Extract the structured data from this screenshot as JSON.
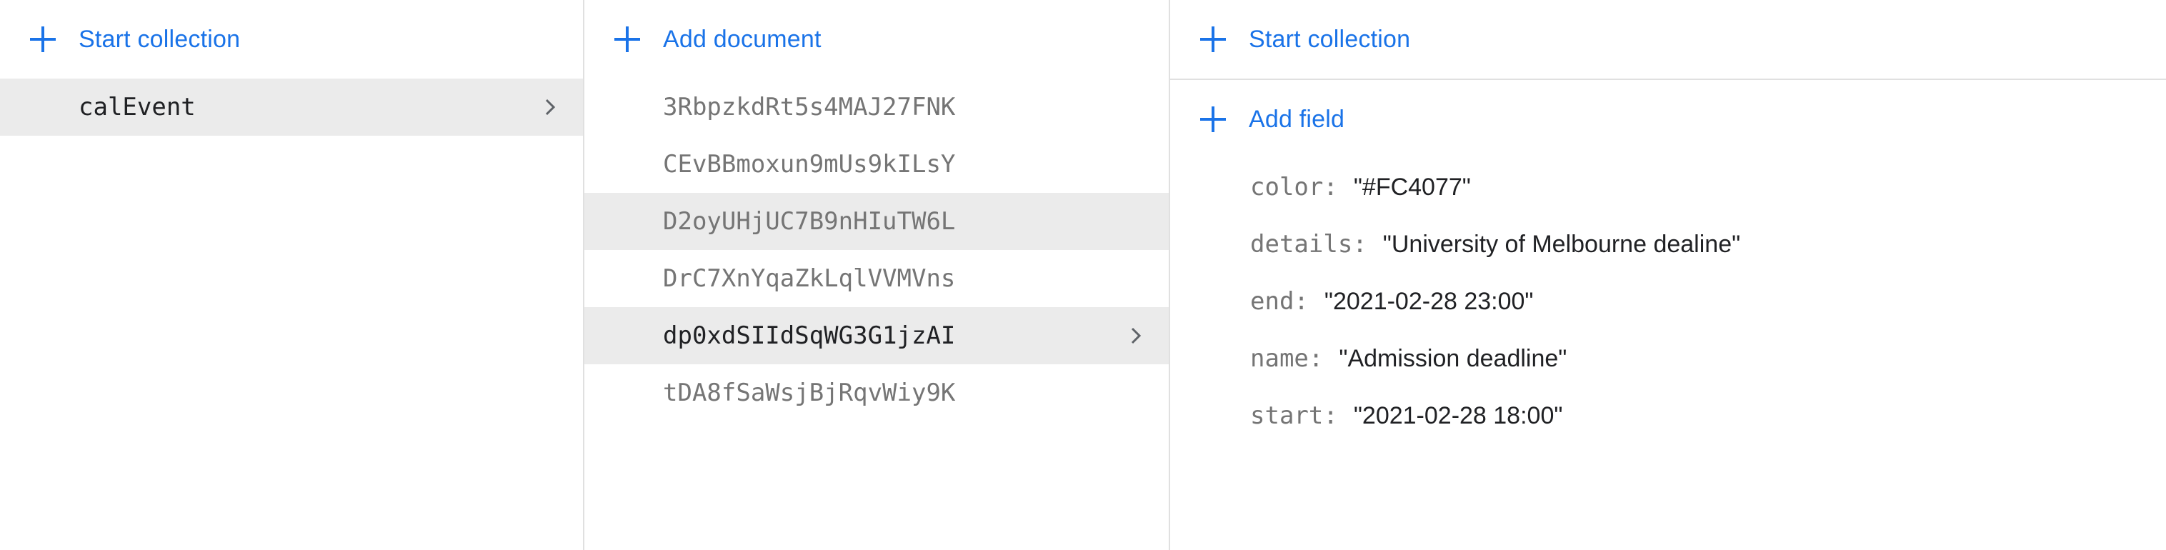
{
  "collections_panel": {
    "action_label": "Start collection",
    "items": [
      {
        "label": "calEvent",
        "state": "selected"
      }
    ]
  },
  "documents_panel": {
    "action_label": "Add document",
    "items": [
      {
        "label": "3RbpzkdRt5s4MAJ27FNK",
        "state": "normal"
      },
      {
        "label": "CEvBBmoxun9mUs9kILsY",
        "state": "normal"
      },
      {
        "label": "D2oyUHjUC7B9nHIuTW6L",
        "state": "hovered"
      },
      {
        "label": "DrC7XnYqaZkLqlVVMVns",
        "state": "normal"
      },
      {
        "label": "dp0xdSIIdSqWG3G1jzAI",
        "state": "selected"
      },
      {
        "label": "tDA8fSaWsjBjRqvWiy9K",
        "state": "normal"
      }
    ]
  },
  "fields_panel": {
    "start_collection_label": "Start collection",
    "add_field_label": "Add field",
    "fields": [
      {
        "key": "color",
        "value": "\"#FC4077\""
      },
      {
        "key": "details",
        "value": "\"University of Melbourne dealine\""
      },
      {
        "key": "end",
        "value": "\"2021-02-28 23:00\""
      },
      {
        "key": "name",
        "value": "\"Admission deadline\""
      },
      {
        "key": "start",
        "value": "\"2021-02-28 18:00\""
      }
    ]
  },
  "colors": {
    "accent": "#1a73e8",
    "selected_bg": "#ebebeb",
    "muted_text": "#757575",
    "divider": "#e0e0e0"
  },
  "icons": {
    "add": "plus-icon",
    "open": "chevron-right-icon"
  }
}
